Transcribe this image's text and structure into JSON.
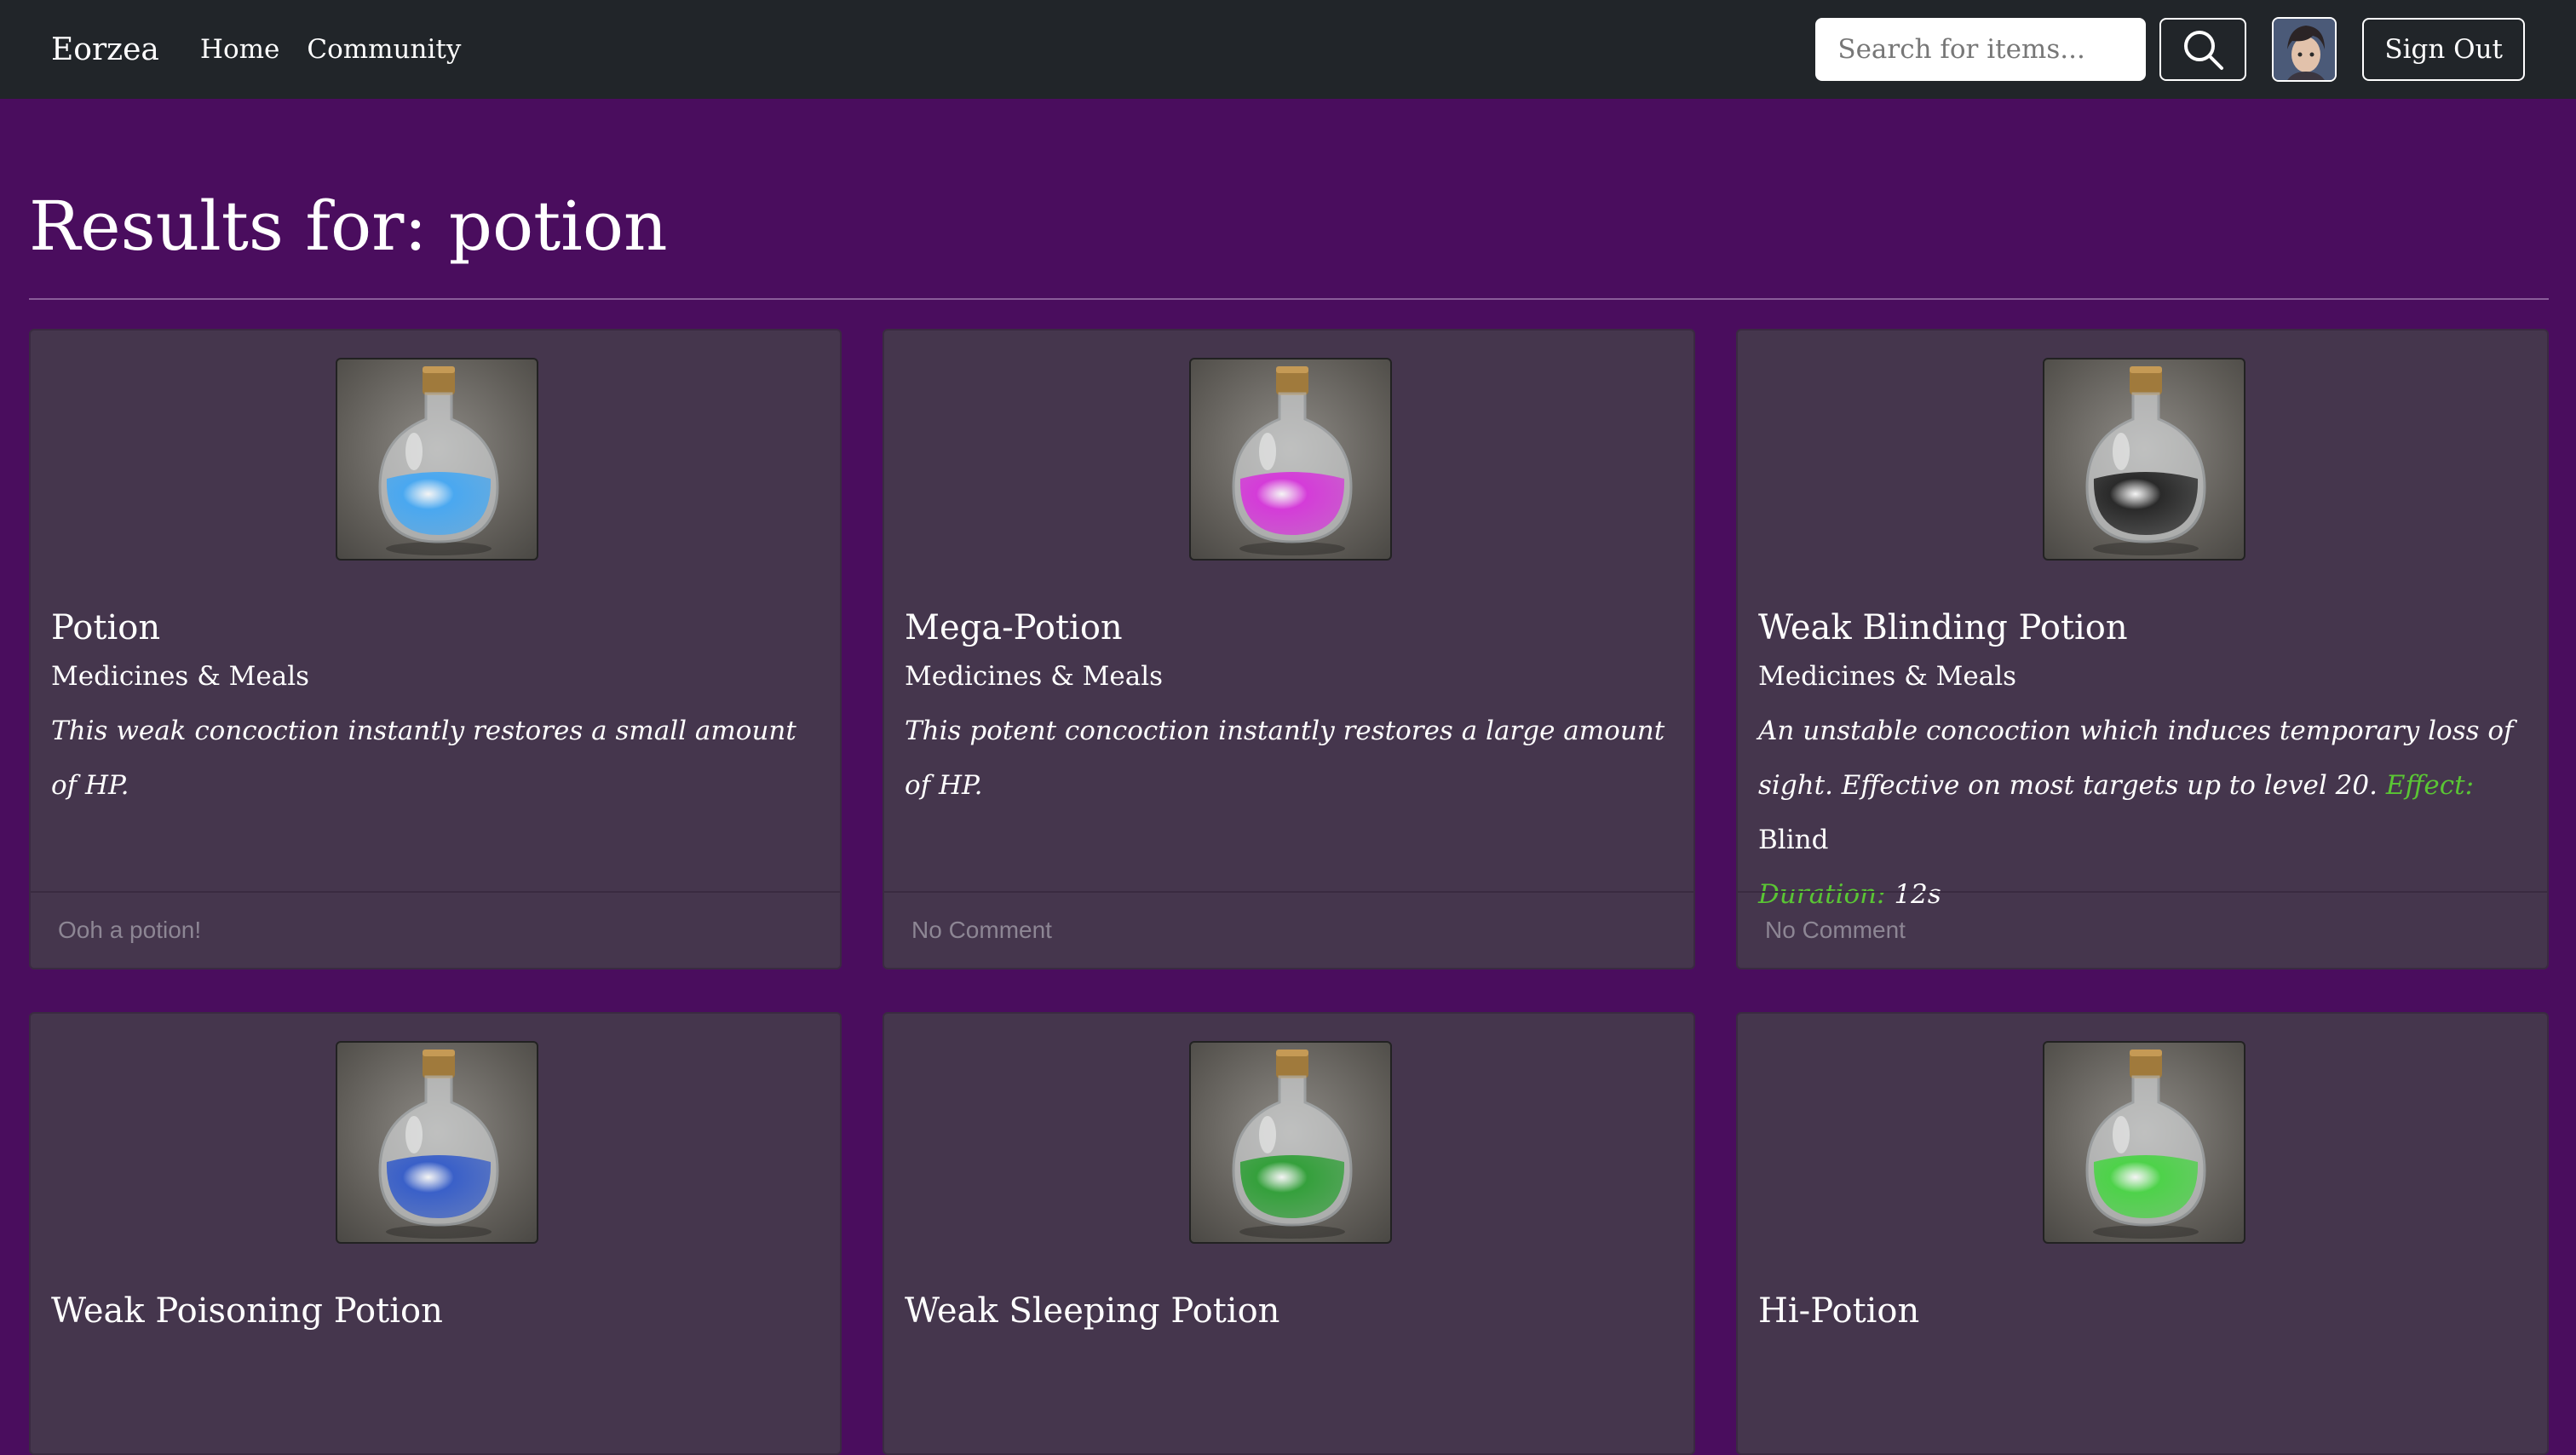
{
  "nav": {
    "brand": "Eorzea",
    "links": [
      "Home",
      "Community"
    ],
    "search_placeholder": "Search for items...",
    "sign_out": "Sign Out"
  },
  "page": {
    "title": "Results for: potion"
  },
  "cards": [
    {
      "title": "Potion",
      "category": "Medicines & Meals",
      "description": "This weak concoction instantly restores a small amount of HP.",
      "comment": "Ooh a potion!",
      "liquid_color": "#4aa8f0"
    },
    {
      "title": "Mega-Potion",
      "category": "Medicines & Meals",
      "description": "This potent concoction instantly restores a large amount of HP.",
      "comment": "No Comment",
      "liquid_color": "#d43cd8"
    },
    {
      "title": "Weak Blinding Potion",
      "category": "Medicines & Meals",
      "description": "An unstable concoction which induces temporary loss of sight. Effective on most targets up to level 20.",
      "effect_label": "Effect:",
      "effect_value": "Blind",
      "duration_label": "Duration:",
      "duration_value": "12s",
      "comment": "No Comment",
      "liquid_color": "#2a2a2a"
    },
    {
      "title": "Weak Poisoning Potion",
      "liquid_color": "#3a60c8"
    },
    {
      "title": "Weak Sleeping Potion",
      "liquid_color": "#35a03c"
    },
    {
      "title": "Hi-Potion",
      "liquid_color": "#4ed24a"
    }
  ]
}
